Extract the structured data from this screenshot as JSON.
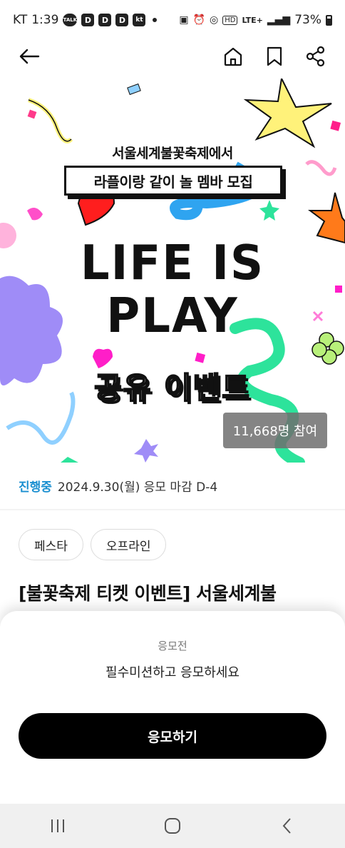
{
  "status_bar": {
    "carrier": "KT",
    "time": "1:39",
    "notification_badges": [
      "TALK",
      "D",
      "D",
      "D",
      "kt"
    ],
    "network": "LTE+",
    "battery": "73%"
  },
  "app_bar": {
    "back_icon": "arrow-left-icon",
    "home_icon": "home-icon",
    "bookmark_icon": "bookmark-icon",
    "share_icon": "share-icon"
  },
  "banner": {
    "subtitle_top": "서울세계불꽃축제에서",
    "subtitle_box": "라플이랑 같이 놀 멤바 모집",
    "headline_line1": "LIFE IS",
    "headline_line2": "PLAY",
    "event_type": "공유 이벤트",
    "participants": "11,668명 참여"
  },
  "event_status": {
    "state": "진행중",
    "detail": "2024.9.30(월) 응모 마감 D-4"
  },
  "tags": [
    "페스타",
    "오프라인"
  ],
  "event_title": "[불꽃축제 티켓 이벤트] 서울세계불",
  "bottom_sheet": {
    "status": "응모전",
    "description": "필수미션하고 응모하세요",
    "apply_label": "응모하기"
  },
  "colors": {
    "accent_blue": "#1a8fd0",
    "button_black": "#000000",
    "confetti_yellow": "#fff27a",
    "confetti_blue": "#2fa4f0",
    "confetti_purple": "#9f8cf7",
    "confetti_green": "#2de39b",
    "confetti_orange": "#ff7a1a",
    "confetti_red": "#ff3a2e"
  }
}
